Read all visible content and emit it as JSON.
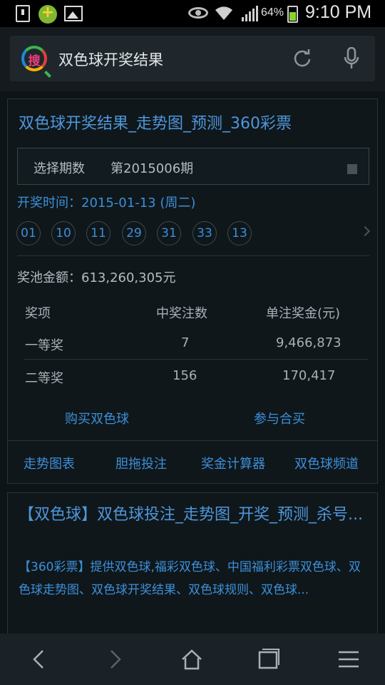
{
  "status_bar": {
    "battery": "64%",
    "time": "9:10 PM"
  },
  "search": {
    "logo_char": "搜",
    "query": "双色球开奖结果"
  },
  "result_card": {
    "title": "双色球开奖结果_走势图_预测_360彩票",
    "period_label": "选择期数",
    "period_value": "第2015006期",
    "draw_time": "开奖时间：2015-01-13 (周二)",
    "balls": [
      "01",
      "10",
      "11",
      "29",
      "31",
      "33",
      "13"
    ],
    "pool": "奖池金额：613,260,305元",
    "table": {
      "headers": [
        "奖项",
        "中奖注数",
        "单注奖金(元)"
      ],
      "rows": [
        [
          "一等奖",
          "7",
          "9,466,873"
        ],
        [
          "二等奖",
          "156",
          "170,417"
        ]
      ]
    },
    "actions": {
      "buy": "购买双色球",
      "join": "参与合买"
    },
    "tabs": [
      "走势图表",
      "胆拖投注",
      "奖金计算器",
      "双色球频道"
    ]
  },
  "second_result": {
    "title": "【双色球】双色球投注_走势图_开奖_预测_杀号...",
    "snippet": "【360彩票】提供双色球,福彩双色球、中国福利彩票双色球、双色球走势图、双色球开奖结果、双色球规则、双色球..."
  },
  "colors": {
    "link": "#3d8fd8",
    "background": "#0d1418",
    "card": "#0f171b"
  }
}
